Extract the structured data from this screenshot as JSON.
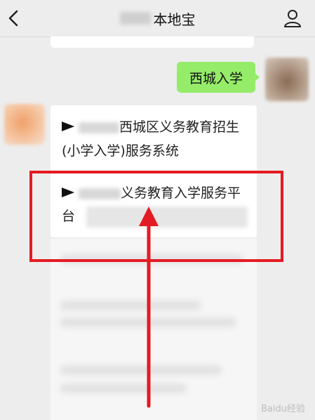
{
  "header": {
    "title": "本地宝"
  },
  "chat": {
    "sent_message": "西城入学",
    "received": {
      "line1_tail": "西城区义务教育招生",
      "line2": "(小学入学)服务系统",
      "line3_tail": "义务教育入学服务平",
      "line4": "台"
    }
  },
  "annotation": {
    "color": "#e31b23"
  },
  "watermark": {
    "text": "Baidu经验"
  }
}
